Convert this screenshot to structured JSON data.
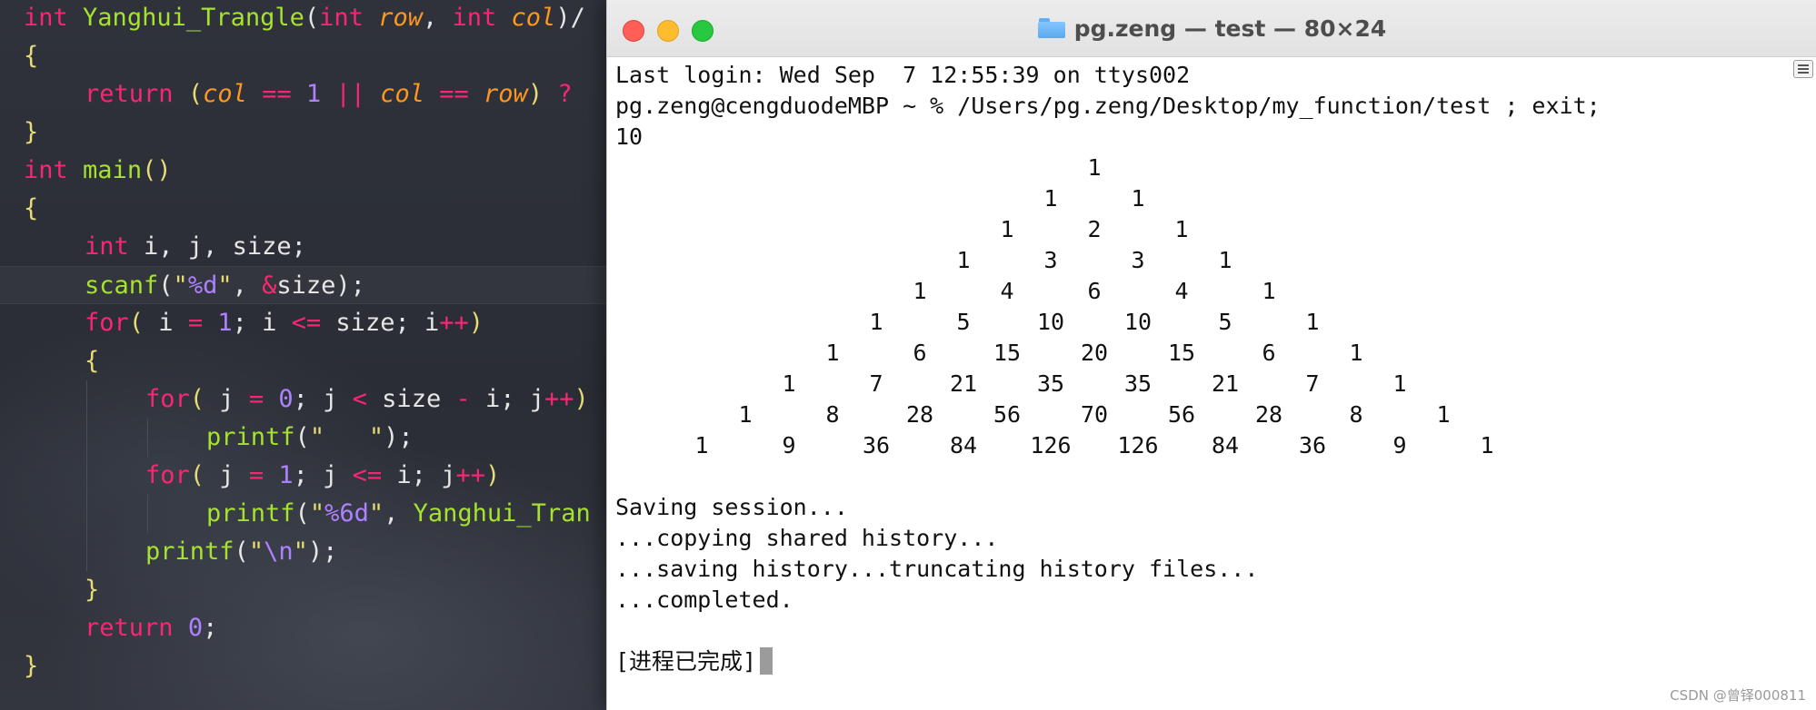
{
  "editor": {
    "lines": [
      {
        "indent": 0,
        "tokens": [
          [
            "kw",
            "int"
          ],
          [
            "pl",
            " "
          ],
          [
            "fn",
            "Yanghui_Trangle"
          ],
          [
            "pl",
            "("
          ],
          [
            "tp",
            "int"
          ],
          [
            "pl",
            " "
          ],
          [
            "par",
            "row"
          ],
          [
            "pl",
            ", "
          ],
          [
            "tp",
            "int"
          ],
          [
            "pl",
            " "
          ],
          [
            "par",
            "col"
          ],
          [
            "pl",
            ")/"
          ]
        ]
      },
      {
        "indent": 0,
        "tokens": [
          [
            "str",
            "{"
          ]
        ]
      },
      {
        "indent": 1,
        "tokens": [
          [
            "kw",
            "return"
          ],
          [
            "pl",
            " "
          ],
          [
            "str",
            "("
          ],
          [
            "par",
            "col"
          ],
          [
            "pl",
            " "
          ],
          [
            "op",
            "=="
          ],
          [
            "pl",
            " "
          ],
          [
            "num",
            "1"
          ],
          [
            "pl",
            " "
          ],
          [
            "op",
            "||"
          ],
          [
            "pl",
            " "
          ],
          [
            "par",
            "col"
          ],
          [
            "pl",
            " "
          ],
          [
            "op",
            "=="
          ],
          [
            "pl",
            " "
          ],
          [
            "par",
            "row"
          ],
          [
            "str",
            ")"
          ],
          [
            "pl",
            " "
          ],
          [
            "op",
            "?"
          ]
        ]
      },
      {
        "indent": 0,
        "tokens": [
          [
            "str",
            "}"
          ]
        ]
      },
      {
        "indent": 0,
        "tokens": [
          [
            "kw",
            "int"
          ],
          [
            "pl",
            " "
          ],
          [
            "fn",
            "main"
          ],
          [
            "str",
            "()"
          ]
        ]
      },
      {
        "indent": 0,
        "tokens": [
          [
            "str",
            "{"
          ]
        ]
      },
      {
        "indent": 1,
        "tokens": [
          [
            "kw",
            "int"
          ],
          [
            "pl",
            " i, j, size;"
          ]
        ]
      },
      {
        "indent": 1,
        "current": true,
        "tokens": [
          [
            "fn",
            "scanf"
          ],
          [
            "pl",
            "("
          ],
          [
            "str",
            "\""
          ],
          [
            "esc",
            "%d"
          ],
          [
            "str",
            "\""
          ],
          [
            "pl",
            ", "
          ],
          [
            "op",
            "&"
          ],
          [
            "pl",
            "size);"
          ]
        ]
      },
      {
        "indent": 1,
        "tokens": [
          [
            "kw",
            "for"
          ],
          [
            "str",
            "("
          ],
          [
            "pl",
            " i "
          ],
          [
            "op",
            "="
          ],
          [
            "pl",
            " "
          ],
          [
            "num",
            "1"
          ],
          [
            "pl",
            "; i "
          ],
          [
            "op",
            "<="
          ],
          [
            "pl",
            " size; i"
          ],
          [
            "op",
            "++"
          ],
          [
            "str",
            ")"
          ]
        ]
      },
      {
        "indent": 1,
        "tokens": [
          [
            "str",
            "{"
          ]
        ]
      },
      {
        "indent": 2,
        "tokens": [
          [
            "kw",
            "for"
          ],
          [
            "str",
            "("
          ],
          [
            "pl",
            " j "
          ],
          [
            "op",
            "="
          ],
          [
            "pl",
            " "
          ],
          [
            "num",
            "0"
          ],
          [
            "pl",
            "; j "
          ],
          [
            "op",
            "<"
          ],
          [
            "pl",
            " size "
          ],
          [
            "op",
            "-"
          ],
          [
            "pl",
            " i; j"
          ],
          [
            "op",
            "++"
          ],
          [
            "str",
            ")"
          ]
        ]
      },
      {
        "indent": 3,
        "tokens": [
          [
            "fn",
            "printf"
          ],
          [
            "pl",
            "("
          ],
          [
            "str",
            "\"   \""
          ],
          [
            "pl",
            ");"
          ]
        ]
      },
      {
        "indent": 2,
        "tokens": [
          [
            "kw",
            "for"
          ],
          [
            "str",
            "("
          ],
          [
            "pl",
            " j "
          ],
          [
            "op",
            "="
          ],
          [
            "pl",
            " "
          ],
          [
            "num",
            "1"
          ],
          [
            "pl",
            "; j "
          ],
          [
            "op",
            "<="
          ],
          [
            "pl",
            " i; j"
          ],
          [
            "op",
            "++"
          ],
          [
            "str",
            ")"
          ]
        ]
      },
      {
        "indent": 3,
        "tokens": [
          [
            "fn",
            "printf"
          ],
          [
            "pl",
            "("
          ],
          [
            "str",
            "\""
          ],
          [
            "esc",
            "%6d"
          ],
          [
            "str",
            "\""
          ],
          [
            "pl",
            ", "
          ],
          [
            "fn",
            "Yanghui_Tran"
          ]
        ]
      },
      {
        "indent": 2,
        "tokens": [
          [
            "fn",
            "printf"
          ],
          [
            "pl",
            "("
          ],
          [
            "str",
            "\""
          ],
          [
            "esc",
            "\\n"
          ],
          [
            "str",
            "\""
          ],
          [
            "pl",
            ");"
          ]
        ]
      },
      {
        "indent": 1,
        "tokens": [
          [
            "str",
            "}"
          ]
        ]
      },
      {
        "indent": 1,
        "tokens": [
          [
            "kw",
            "return"
          ],
          [
            "pl",
            " "
          ],
          [
            "num",
            "0"
          ],
          [
            "pl",
            ";"
          ]
        ]
      },
      {
        "indent": 0,
        "tokens": [
          [
            "str",
            "}"
          ]
        ]
      }
    ]
  },
  "terminal": {
    "title": "pg.zeng — test — 80×24",
    "title_icon": "folder-icon",
    "last_login": "Last login: Wed Sep  7 12:55:39 on ttys002",
    "prompt": "pg.zeng@cengduodeMBP ~ % /Users/pg.zeng/Desktop/my_function/test ; exit;",
    "input_value": "10",
    "triangle_rows": [
      [
        1
      ],
      [
        1,
        1
      ],
      [
        1,
        2,
        1
      ],
      [
        1,
        3,
        3,
        1
      ],
      [
        1,
        4,
        6,
        4,
        1
      ],
      [
        1,
        5,
        10,
        10,
        5,
        1
      ],
      [
        1,
        6,
        15,
        20,
        15,
        6,
        1
      ],
      [
        1,
        7,
        21,
        35,
        35,
        21,
        7,
        1
      ],
      [
        1,
        8,
        28,
        56,
        70,
        56,
        28,
        8,
        1
      ],
      [
        1,
        9,
        36,
        84,
        126,
        126,
        84,
        36,
        9,
        1
      ]
    ],
    "session_lines": [
      "Saving session...",
      "...copying shared history...",
      "...saving history...truncating history files...",
      "...completed."
    ],
    "completion": "[进程已完成]"
  },
  "watermark": "CSDN @曾铎000811",
  "colors": {
    "editor_bg": "#2a2d35",
    "terminal_bg": "#ffffff",
    "keyword": "#f92672",
    "function": "#a6e22e",
    "string": "#e6db74",
    "number": "#ae81ff",
    "param": "#fd971f",
    "close": "#ff5f57",
    "minimize": "#febc2e",
    "maximize": "#28c840"
  }
}
